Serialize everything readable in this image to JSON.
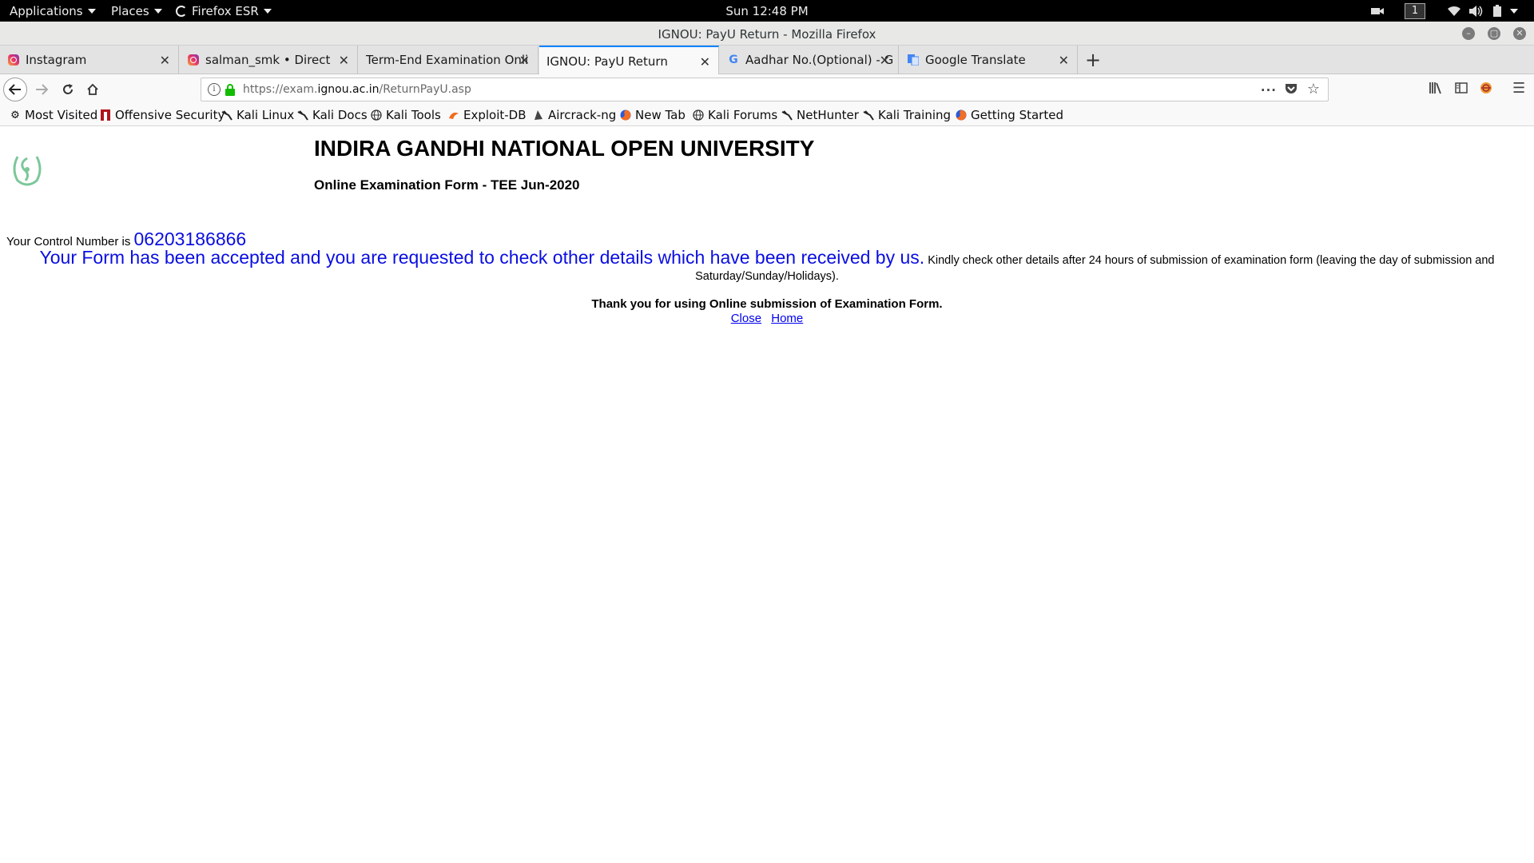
{
  "topbar": {
    "applications": "Applications",
    "places": "Places",
    "app_name": "Firefox ESR",
    "clock": "Sun 12:48 PM",
    "workspace": "1"
  },
  "window": {
    "title": "IGNOU: PayU Return - Mozilla Firefox"
  },
  "tabs": [
    {
      "label": "Instagram",
      "icon": "instagram-icon"
    },
    {
      "label": "salman_smk • Direct",
      "icon": "instagram-icon"
    },
    {
      "label": "Term-End Examination Onli",
      "icon": "none"
    },
    {
      "label": "IGNOU: PayU Return",
      "icon": "none",
      "active": true
    },
    {
      "label": "Aadhar No.(Optional) - G",
      "icon": "google-icon"
    },
    {
      "label": "Google Translate",
      "icon": "google-translate-icon"
    }
  ],
  "urlbar": {
    "prefix": "https://exam.",
    "host": "ignou.ac.in",
    "path": "/ReturnPayU.asp"
  },
  "bookmarks": [
    {
      "label": "Most Visited",
      "icon": "gear-icon"
    },
    {
      "label": "Offensive Security",
      "icon": "offsec-icon"
    },
    {
      "label": "Kali Linux",
      "icon": "kali-dragon-icon"
    },
    {
      "label": "Kali Docs",
      "icon": "kali-dragon-icon"
    },
    {
      "label": "Kali Tools",
      "icon": "globe-icon"
    },
    {
      "label": "Exploit-DB",
      "icon": "exploitdb-icon"
    },
    {
      "label": "Aircrack-ng",
      "icon": "aircrack-icon"
    },
    {
      "label": "New Tab",
      "icon": "firefox-icon"
    },
    {
      "label": "Kali Forums",
      "icon": "globe-icon"
    },
    {
      "label": "NetHunter",
      "icon": "kali-dragon-icon"
    },
    {
      "label": "Kali Training",
      "icon": "kali-dragon-icon"
    },
    {
      "label": "Getting Started",
      "icon": "firefox-icon"
    }
  ],
  "content": {
    "university": "INDIRA GANDHI NATIONAL OPEN UNIVERSITY",
    "subtitle": "Online Examination Form - TEE Jun-2020",
    "control_label": "Your Control Number is ",
    "control_number": "06203186866",
    "accepted_message": "Your Form has been accepted and you are requested to check other details which have been received by us.",
    "kindly_note": "Kindly check other details after 24 hours of submission of examination form (leaving the day of submission and Saturday/Sunday/Holidays).",
    "thanks": "Thank you for using Online submission of Examination Form.",
    "close_link": "Close",
    "home_link": "Home"
  },
  "colors": {
    "accent_blue": "#0a0ee0",
    "link_blue": "#0000ee",
    "logo_green": "#6fbf8f",
    "tab_accent": "#0a84ff"
  }
}
